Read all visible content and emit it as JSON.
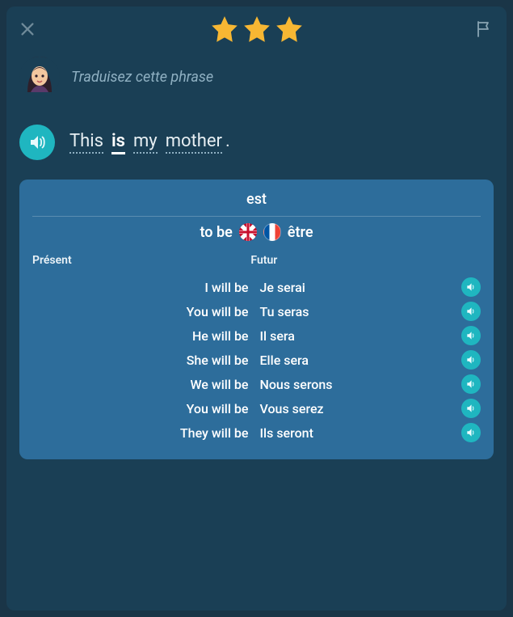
{
  "header": {
    "stars": 3
  },
  "instruction": {
    "text": "Traduisez cette phrase"
  },
  "sentence": {
    "words": [
      "This",
      "is",
      "my",
      "mother"
    ],
    "active_index": 1,
    "suffix": "."
  },
  "popup": {
    "word": "est",
    "verb_source": "to be",
    "verb_target": "être",
    "tense_left": "Présent",
    "tense_center": "Futur",
    "conjugations": [
      {
        "en": "I will be",
        "fr": "Je serai"
      },
      {
        "en": "You will be",
        "fr": "Tu seras"
      },
      {
        "en": "He will be",
        "fr": "Il sera"
      },
      {
        "en": "She will be",
        "fr": "Elle sera"
      },
      {
        "en": "We will be",
        "fr": "Nous serons"
      },
      {
        "en": "You will be",
        "fr": "Vous serez"
      },
      {
        "en": "They will be",
        "fr": "Ils seront"
      }
    ]
  }
}
